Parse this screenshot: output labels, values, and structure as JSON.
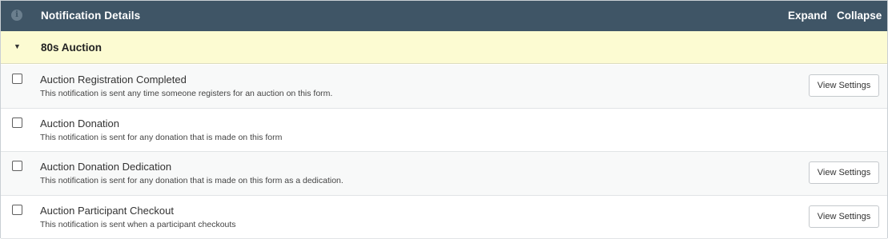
{
  "header": {
    "title": "Notification Details",
    "info_icon_glyph": "i",
    "expand_label": "Expand",
    "collapse_label": "Collapse"
  },
  "group": {
    "caret": "▼",
    "title": "80s Auction"
  },
  "notifications": [
    {
      "title": "Auction Registration Completed",
      "description": "This notification is sent any time someone registers for an auction on this form.",
      "checked": false,
      "button_label": "View Settings"
    },
    {
      "title": "Auction Donation",
      "description": "This notification is sent for any donation that is made on this form",
      "checked": false,
      "button_label": null
    },
    {
      "title": "Auction Donation Dedication",
      "description": "This notification is sent for any donation that is made on this form as a dedication.",
      "checked": false,
      "button_label": "View Settings"
    },
    {
      "title": "Auction Participant Checkout",
      "description": "This notification is sent when a participant checkouts",
      "checked": false,
      "button_label": "View Settings"
    }
  ],
  "colors": {
    "header_bg": "#3f5566",
    "group_bg": "#fcfbd2",
    "row_alt_bg": "#f8f9f9"
  }
}
